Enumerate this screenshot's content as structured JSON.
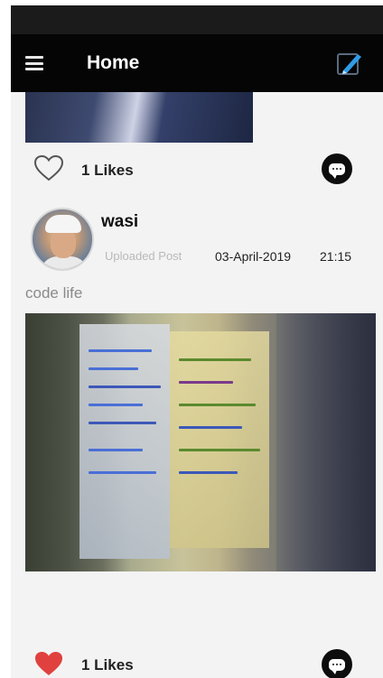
{
  "app_bar": {
    "title": "Home",
    "menu_icon": "hamburger-menu-icon",
    "compose_icon": "compose-pen-icon"
  },
  "posts": [
    {
      "likes_label": "1 Likes",
      "liked": false
    },
    {
      "username": "wasi",
      "upload_label": "Uploaded Post",
      "date": "03-April-2019",
      "time": "21:15",
      "caption": "code life",
      "likes_label": "1 Likes",
      "liked": true
    }
  ],
  "colors": {
    "app_bar": "#050505",
    "status_bar": "#1b1b1b",
    "background": "#f3f3f3",
    "liked_heart": "#e0413f",
    "comment_button": "#0d0d0d"
  }
}
